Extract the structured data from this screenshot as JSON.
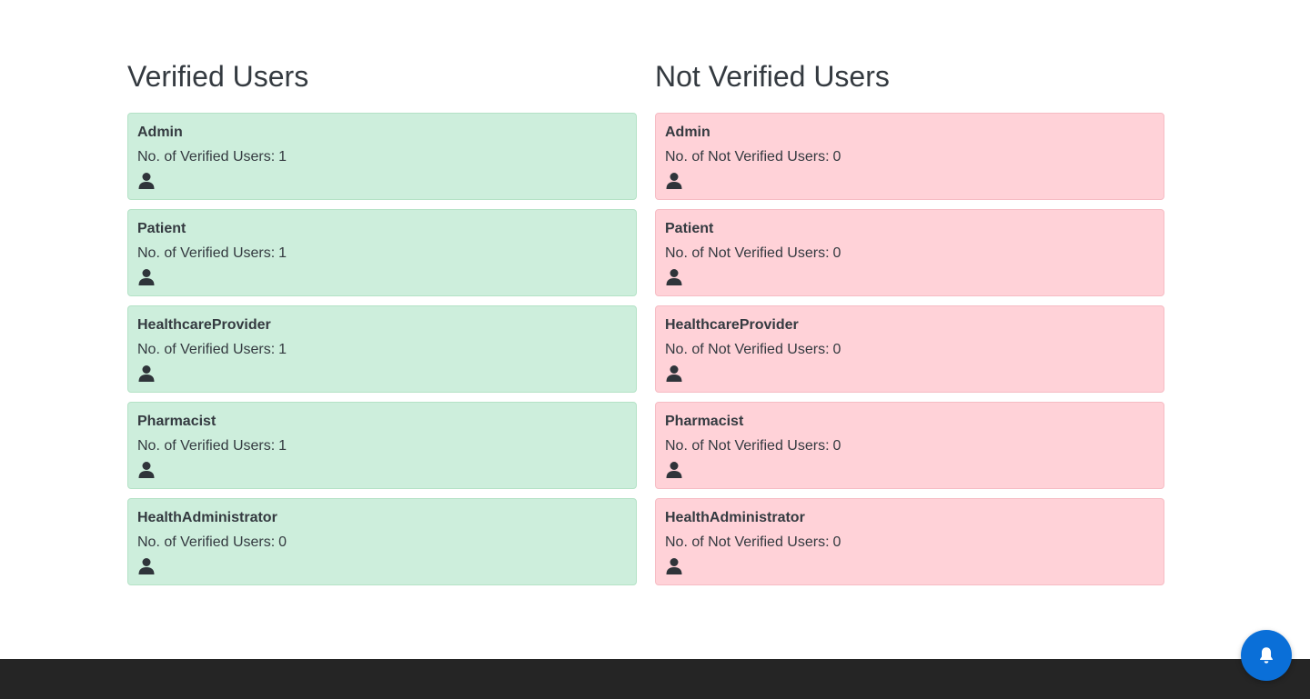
{
  "verified": {
    "title": "Verified Users",
    "count_label": "No. of Verified Users:",
    "items": [
      {
        "role": "Admin",
        "count": "1",
        "icon": "user-icon"
      },
      {
        "role": "Patient",
        "count": "1",
        "icon": "user-icon"
      },
      {
        "role": "HealthcareProvider",
        "count": "1",
        "icon": "user-icon"
      },
      {
        "role": "Pharmacist",
        "count": "1",
        "icon": "user-icon"
      },
      {
        "role": "HealthAdministrator",
        "count": "0",
        "icon": "user-icon"
      }
    ]
  },
  "not_verified": {
    "title": "Not Verified Users",
    "count_label": "No. of Not Verified Users:",
    "items": [
      {
        "role": "Admin",
        "count": "0",
        "icon": "user-icon"
      },
      {
        "role": "Patient",
        "count": "0",
        "icon": "user-icon"
      },
      {
        "role": "HealthcareProvider",
        "count": "0",
        "icon": "user-icon"
      },
      {
        "role": "Pharmacist",
        "count": "0",
        "icon": "user-icon"
      },
      {
        "role": "HealthAdministrator",
        "count": "0",
        "icon": "user-icon"
      }
    ]
  },
  "notification_button": {
    "icon": "bell-icon"
  },
  "colors": {
    "verified_bg": "#cdeedc",
    "not_verified_bg": "#ffd2d8",
    "footer_bg": "#252525",
    "accent": "#0a6fd8"
  }
}
